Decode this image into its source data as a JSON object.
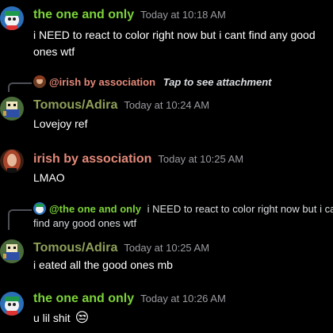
{
  "messages": [
    {
      "author": "the one and only",
      "time": "Today at 10:18 AM",
      "lines": [
        "i NEED to react to color right now but i cant find any good",
        "ones wtf"
      ]
    },
    {
      "reply_author": "@irish by association",
      "reply_text": "Tap to see attachment",
      "author": "Tomous/Adira",
      "time": "Today at 10:24 AM",
      "lines": [
        "Lovejoy ref"
      ]
    },
    {
      "author": "irish by association",
      "time": "Today at 10:25 AM",
      "lines": [
        "LMAO"
      ]
    },
    {
      "reply_author": "@the one and only",
      "reply_text": "i NEED to react to color right now but i can",
      "reply_text_line2": "find any good ones wtf",
      "author": "Tomous/Adira",
      "time": "Today at 10:25 AM",
      "lines": [
        "i eated all the good ones mb"
      ]
    },
    {
      "author": "the one and only",
      "time": "Today at 10:26 AM",
      "lines": [
        "u lil shit"
      ],
      "emoji": "😒"
    }
  ],
  "colors": {
    "the_one_and_only": "#7cd33a",
    "tomous_adira": "#8fa05a",
    "irish_by_association": "#e58a7a",
    "timestamp": "#9a9ba1",
    "background": "#000000"
  },
  "icons": {
    "avatar_the_one_and_only": "cartoon-penguin-icon",
    "avatar_tomous_adira": "pixel-character-icon",
    "avatar_irish": "portrait-photo"
  }
}
